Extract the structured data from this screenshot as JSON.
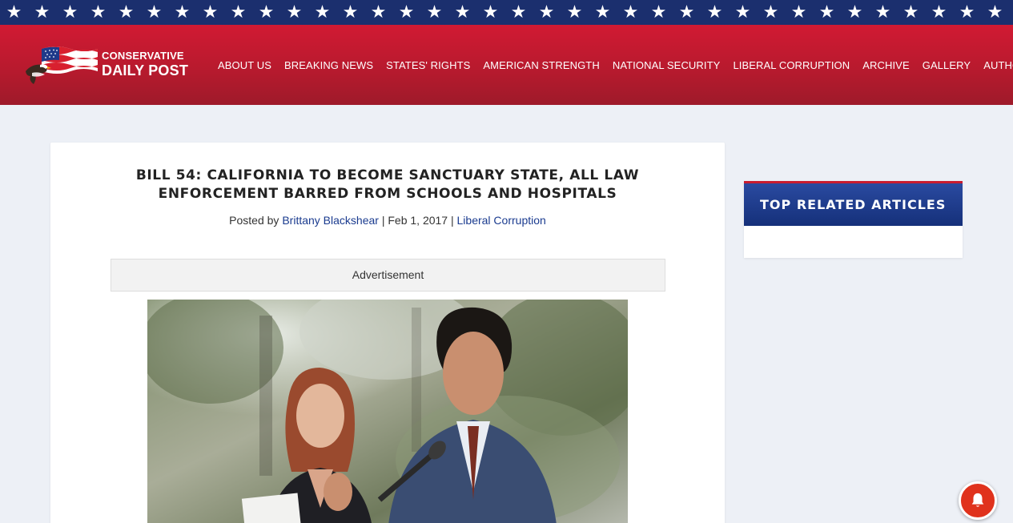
{
  "stars": {
    "glyph": "★",
    "count": 37
  },
  "logo": {
    "line1": "CONSERVATIVE",
    "line2": "DAILY POST"
  },
  "nav": {
    "items": [
      {
        "label": "ABOUT US"
      },
      {
        "label": "BREAKING NEWS"
      },
      {
        "label": "STATES' RIGHTS"
      },
      {
        "label": "AMERICAN STRENGTH"
      },
      {
        "label": "NATIONAL SECURITY"
      },
      {
        "label": "LIBERAL CORRUPTION"
      },
      {
        "label": "ARCHIVE"
      },
      {
        "label": "GALLERY"
      },
      {
        "label": "AUTHORS"
      }
    ]
  },
  "post": {
    "title": "BILL 54: CALIFORNIA TO BECOME SANCTUARY STATE, ALL LAW ENFORCEMENT BARRED FROM SCHOOLS AND HOSPITALS",
    "posted_by": "Posted by",
    "author": "Brittany Blackshear",
    "separator": "|",
    "date": "Feb 1, 2017",
    "category": "Liberal Corruption"
  },
  "ad": {
    "label": "Advertisement"
  },
  "sidebar": {
    "widget_title": "TOP RELATED ARTICLES"
  },
  "notification": {
    "icon": "bell-icon"
  },
  "colors": {
    "header_red": "#c41a30",
    "star_band_blue": "#1b2f6e",
    "widget_blue": "#15307a",
    "link_blue": "#1a3b8f",
    "bell_red": "#e0321c"
  }
}
